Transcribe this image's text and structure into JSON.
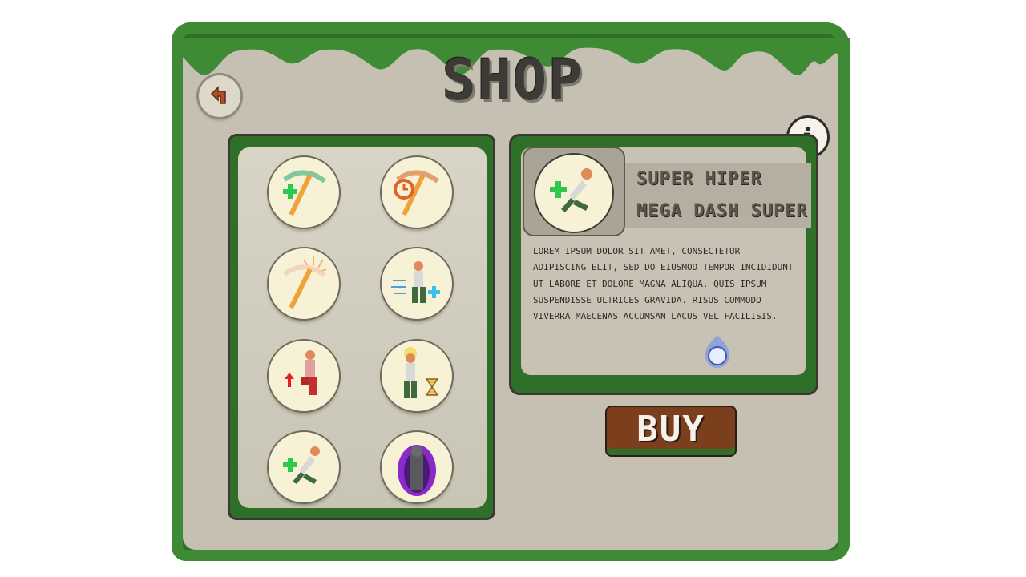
{
  "header": {
    "title": "SHOP"
  },
  "colors": {
    "board": "#c5c0b2",
    "moss": "#3f8a34",
    "title": "#3d3b35",
    "buy_button": "#7c3f1e"
  },
  "nav": {
    "back_icon": "back-arrow-icon",
    "info_icon": "info-icon",
    "info_label": "i"
  },
  "items": [
    {
      "icon": "pickaxe-heal-icon"
    },
    {
      "icon": "pickaxe-speed-icon"
    },
    {
      "icon": "pickaxe-power-icon"
    },
    {
      "icon": "dash-speed-icon"
    },
    {
      "icon": "jump-boost-icon"
    },
    {
      "icon": "time-slow-icon"
    },
    {
      "icon": "dash-heal-icon"
    },
    {
      "icon": "shadow-cloak-icon"
    }
  ],
  "selected_item": {
    "name_line1": "SUPER HIPER",
    "name_line2": "MEGA DASH SUPER",
    "description": "LOREM IPSUM DOLOR SIT AMET, CONSECTETUR ADIPISCING ELIT, SED DO EIUSMOD TEMPOR INCIDIDUNT UT LABORE ET DOLORE MAGNA ALIQUA. QUIS IPSUM SUSPENDISSE ULTRICES GRAVIDA. RISUS COMMODO VIVERRA MAECENAS ACCUMSAN LACUS VEL FACILISIS.",
    "currency_icon": "blue-orb-icon"
  },
  "actions": {
    "buy_label": "BUY"
  }
}
